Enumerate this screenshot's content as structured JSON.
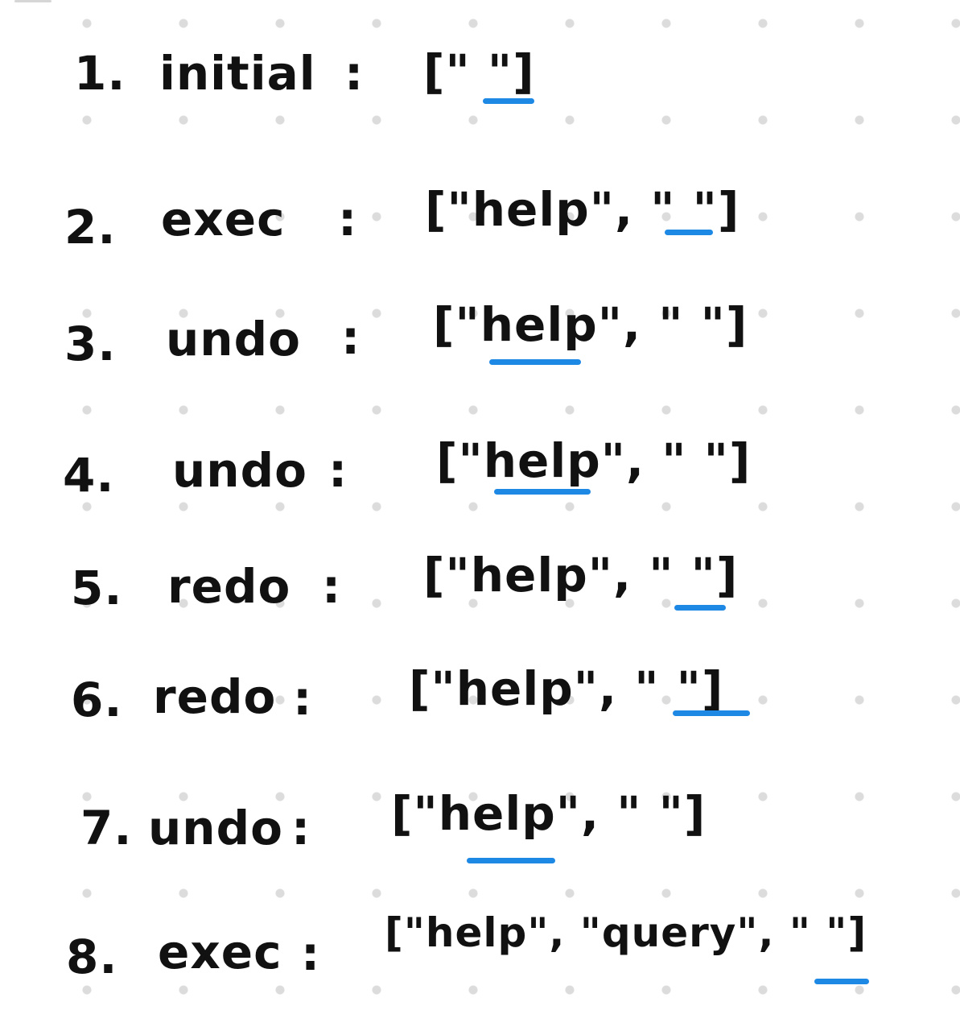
{
  "accent_color": "#1e88e5",
  "ink_color": "#111111",
  "steps": [
    {
      "number": "1.",
      "operation": "initial",
      "colon": ":",
      "stack": "[\" \"]"
    },
    {
      "number": "2.",
      "operation": "exec",
      "colon": ":",
      "stack": "[\"help\", \" \"]"
    },
    {
      "number": "3.",
      "operation": "undo",
      "colon": ":",
      "stack": "[\"help\", \" \"]"
    },
    {
      "number": "4.",
      "operation": "undo",
      "colon": ":",
      "stack": "[\"help\", \" \"]"
    },
    {
      "number": "5.",
      "operation": "redo",
      "colon": ":",
      "stack": "[\"help\", \" \"]"
    },
    {
      "number": "6.",
      "operation": "redo",
      "colon": ":",
      "stack": "[\"help\", \" \"]"
    },
    {
      "number": "7.",
      "operation": "undo",
      "colon": ":",
      "stack": "[\"help\", \" \"]"
    },
    {
      "number": "8.",
      "operation": "exec",
      "colon": ":",
      "stack": "[\"help\", \"query\", \" \"]"
    }
  ]
}
